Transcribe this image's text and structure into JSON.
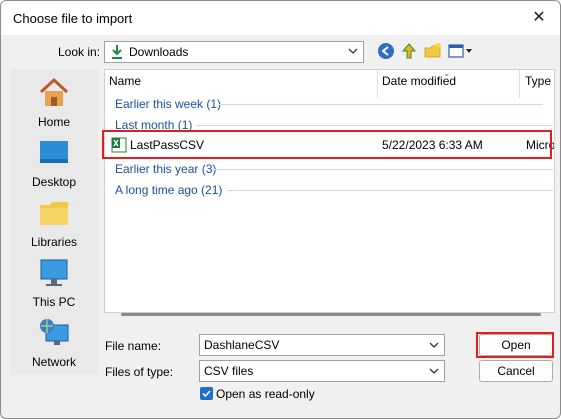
{
  "window": {
    "title": "Choose file to import",
    "close_glyph": "✕"
  },
  "lookin": {
    "label": "Look in:",
    "value": "Downloads"
  },
  "toolbar": {
    "icons": [
      "back-icon",
      "up-folder-icon",
      "new-folder-icon",
      "view-menu-icon"
    ]
  },
  "places": [
    {
      "label": "Home",
      "icon": "home-icon"
    },
    {
      "label": "Desktop",
      "icon": "desktop-icon"
    },
    {
      "label": "Libraries",
      "icon": "libraries-icon"
    },
    {
      "label": "This PC",
      "icon": "this-pc-icon"
    },
    {
      "label": "Network",
      "icon": "network-icon"
    }
  ],
  "filelist": {
    "columns": [
      "Name",
      "Date modified",
      "Type"
    ],
    "groups": [
      "Earlier this week (1)",
      "Last month (1)",
      "Earlier this year (3)",
      "A long time ago (21)"
    ],
    "file": {
      "name": "LastPassCSV",
      "date": "5/22/2023 6:33 AM",
      "type": "Micro"
    }
  },
  "form": {
    "filename_label": "File name:",
    "filename_value": "DashlaneCSV",
    "filetype_label": "Files of type:",
    "filetype_value": "CSV files",
    "readonly_label": "Open as read-only",
    "readonly_checked": true
  },
  "buttons": {
    "open": "Open",
    "cancel": "Cancel"
  },
  "colors": {
    "highlight": "#e02020",
    "group_text": "#1a4fa3",
    "checkbox": "#1f6fd1"
  }
}
